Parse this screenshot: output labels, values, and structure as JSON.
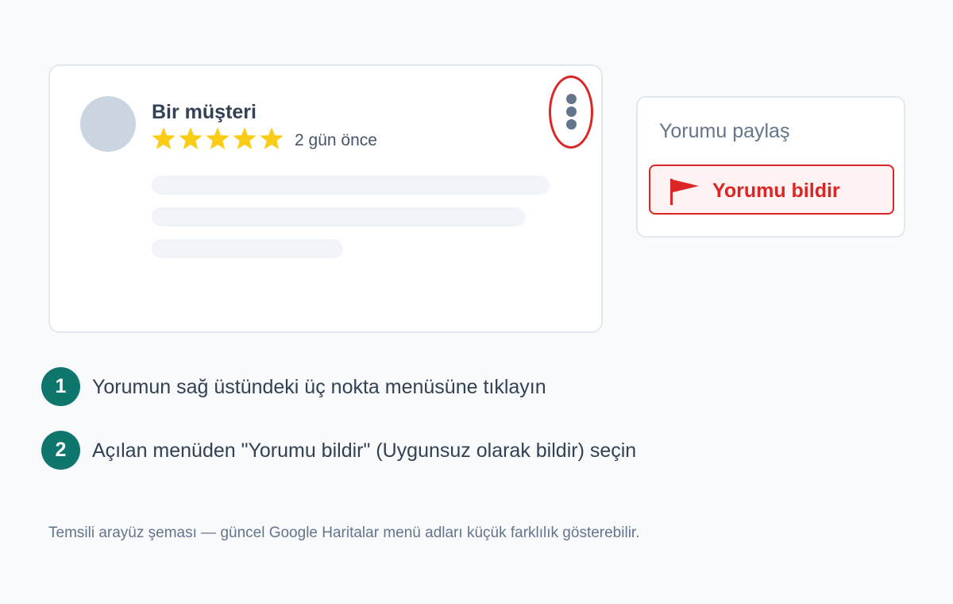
{
  "review": {
    "reviewer_name": "Bir müşteri",
    "rating": 5,
    "rating_max": 5,
    "date": "2 gün önce",
    "text_placeholder_lines": 3
  },
  "menu": {
    "share_label": "Yorumu paylaş",
    "report_label": "Yorumu bildir"
  },
  "steps": [
    {
      "number": "1",
      "text": "Yorumun sağ üstündeki üç nokta menüsüne tıklayın"
    },
    {
      "number": "2",
      "text": "Açılan menüden \"Yorumu bildir\" (Uygunsuz olarak bildir) seçin"
    }
  ],
  "footnote": "Temsili arayüz şeması — güncel Google Haritalar menü adları küçük farklılık gösterebilir.",
  "colors": {
    "accent_red": "#dc2626",
    "star_yellow": "#facc15",
    "badge_teal": "#0f766e",
    "avatar_gray": "#cbd5e1"
  },
  "icons": {
    "more": "more-vert-icon",
    "star": "star-icon",
    "flag": "flag-icon"
  }
}
